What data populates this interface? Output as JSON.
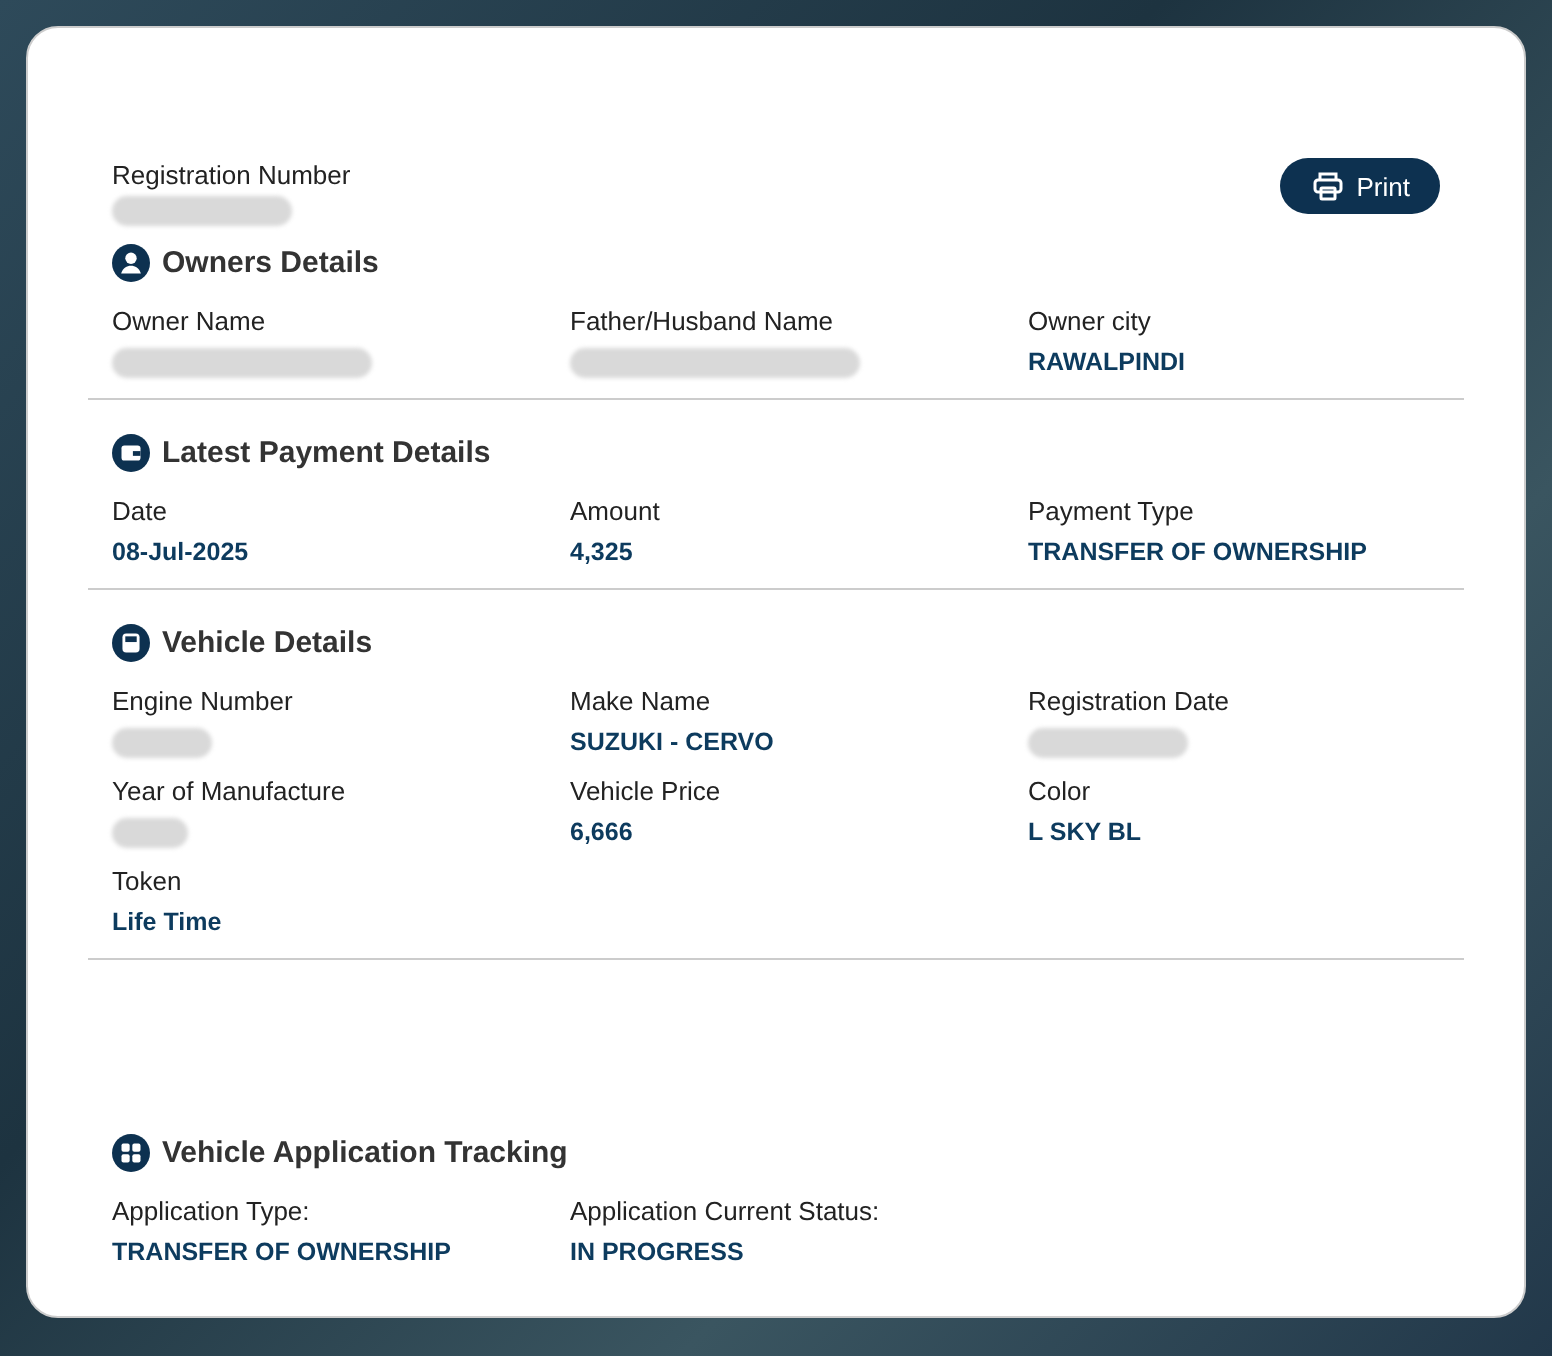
{
  "registration": {
    "label": "Registration Number",
    "redacted": true
  },
  "print_button": {
    "label": "Print"
  },
  "sections": [
    {
      "title": "Owners Details",
      "divider": true,
      "fields": [
        {
          "label": "Owner Name",
          "redacted": true
        },
        {
          "label": "Father/Husband Name",
          "redacted": true
        },
        {
          "label": "Owner city",
          "value": "RAWALPINDI"
        }
      ]
    },
    {
      "title": "Latest Payment Details",
      "divider": true,
      "fields": [
        {
          "label": "Date",
          "value": "08-Jul-2025"
        },
        {
          "label": "Amount",
          "value": "4,325"
        },
        {
          "label": "Payment Type",
          "value": "TRANSFER OF OWNERSHIP"
        }
      ]
    },
    {
      "title": "Vehicle Details",
      "divider": true,
      "fields": [
        {
          "label": "Engine Number",
          "redacted": true
        },
        {
          "label": "Make Name",
          "value": "SUZUKI - CERVO"
        },
        {
          "label": "Registration Date",
          "redacted": true
        },
        {
          "label": "Year of Manufacture",
          "redacted": true
        },
        {
          "label": "Vehicle Price",
          "value": "6,666"
        },
        {
          "label": "Color",
          "value": "L SKY BL"
        },
        {
          "label": "Token",
          "value": "Life Time"
        }
      ]
    },
    {
      "title": "Vehicle Application Tracking",
      "divider": false,
      "fields": [
        {
          "label": "Application Type:",
          "value": "TRANSFER OF OWNERSHIP"
        },
        {
          "label": "Application Current Status:",
          "value": "IN PROGRESS"
        }
      ]
    }
  ]
}
